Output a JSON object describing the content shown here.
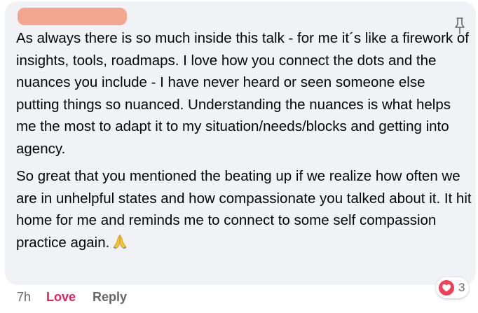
{
  "comment": {
    "paragraphs": [
      "As always there is so much inside this talk - for me it´s like a firework of insights, tools, roadmaps. I love how you connect the dots and the nuances you include - I have never heard or seen someone else putting things so nuanced. Understanding the nuances is what helps me the most to adapt it to my situation/needs/blocks and getting into agency.",
      "So great that you mentioned the beating up if we realize how often we are in unhelpful states and how compassionate you talked about it. It hit home for me and reminds me to connect to some self compassion practice again."
    ],
    "emoji": "folded-hands-emoji"
  },
  "actions": {
    "timestamp": "7h",
    "love_label": "Love",
    "reply_label": "Reply"
  },
  "reactions": {
    "icon": "heart-icon",
    "count": "3"
  },
  "colors": {
    "bubble_bg": "#f0f2f5",
    "author_redaction": "#f4a590",
    "love_accent": "#e0245e",
    "heart_bg": "#f33e58",
    "muted_text": "#65676b"
  },
  "icons": {
    "pin": "pin-icon"
  }
}
